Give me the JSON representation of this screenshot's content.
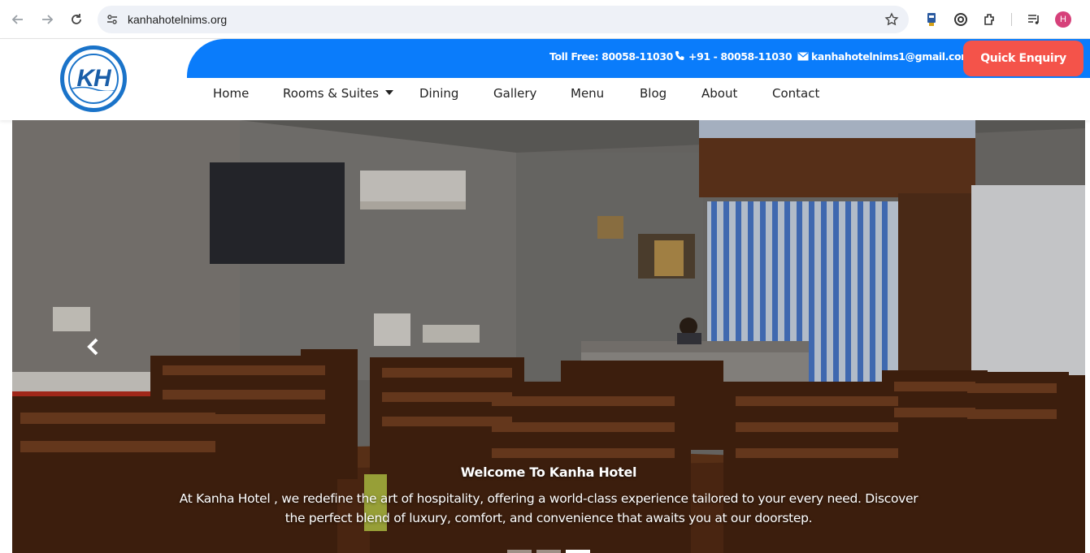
{
  "browser": {
    "url": "kanhahotelnims.org",
    "profile_initial": "H"
  },
  "header": {
    "logo_text": "KH",
    "toll_free": "Toll Free: 80058-11030",
    "phone": "+91 - 80058-11030",
    "email": "kanhahotelnims1@gmail.com",
    "enquiry_label": "Quick Enquiry",
    "nav": {
      "home": "Home",
      "rooms": "Rooms & Suites",
      "dining": "Dining",
      "gallery": "Gallery",
      "menu": "Menu",
      "blog": "Blog",
      "about": "About",
      "contact": "Contact"
    }
  },
  "hero": {
    "title": "Welcome To Kanha Hotel",
    "text": "At Kanha Hotel , we redefine the art of hospitality, offering a world-class experience tailored to your every need. Discover the perfect blend of luxury, comfort, and convenience that awaits you at our doorstep.",
    "slide_count": 3,
    "active_slide": 3
  },
  "colors": {
    "topbar_blue": "#0a7cfb",
    "enquiry_red": "#f4534a",
    "logo_blue": "#1a73c9"
  },
  "icons": [
    "back-icon",
    "forward-icon",
    "reload-icon",
    "site-info-icon",
    "star-icon",
    "extension-icon",
    "phone-icon",
    "mail-icon",
    "chevron-left-icon"
  ]
}
